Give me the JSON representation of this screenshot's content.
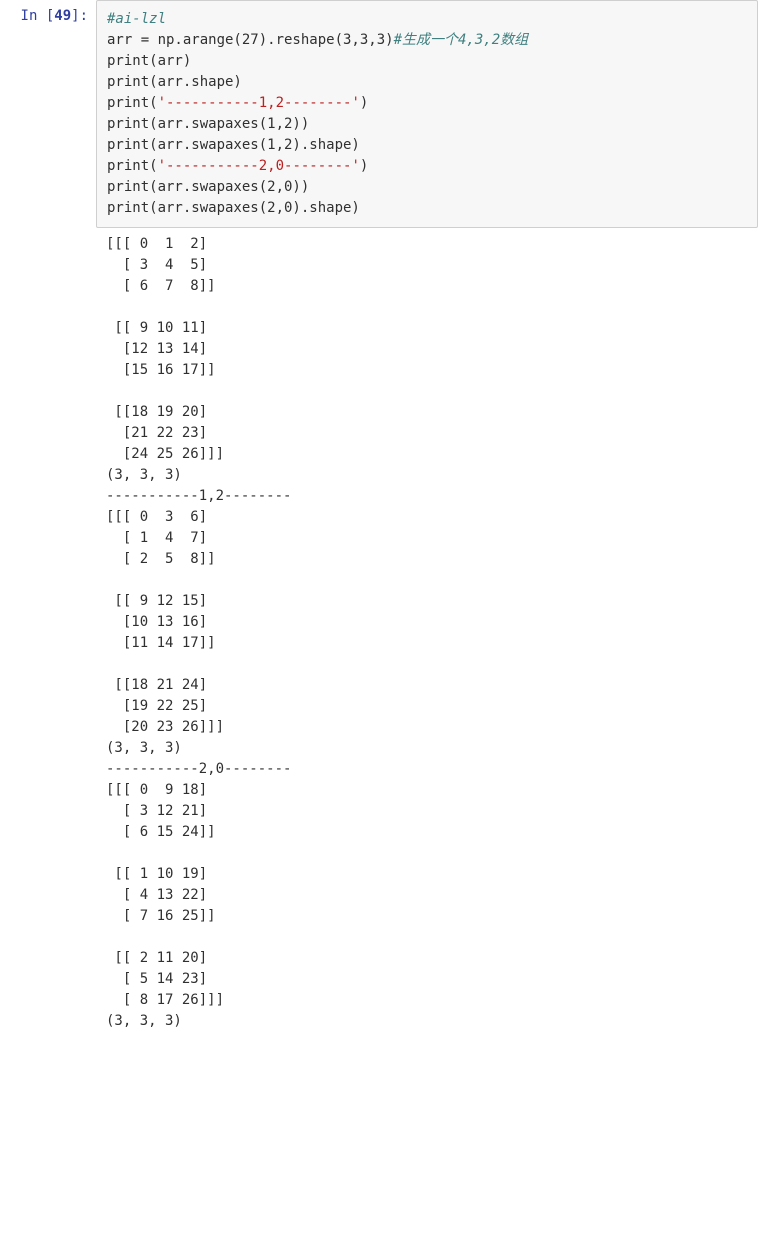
{
  "prompt": {
    "label": "In ",
    "open": "[",
    "number": "49",
    "close": "]:"
  },
  "code": {
    "line1_comment": "#ai-lzl",
    "line2_left": "arr = np.arange(27).reshape(3,3,3)",
    "line2_comment": "#生成一个4,3,2数组",
    "line3": "print(arr)",
    "line4": "print(arr.shape)",
    "line5_call": "print(",
    "line5_str": "'-----------1,2--------'",
    "line5_end": ")",
    "line6": "print(arr.swapaxes(1,2))",
    "line7": "print(arr.swapaxes(1,2).shape)",
    "line8_call": "print(",
    "line8_str": "'-----------2,0--------'",
    "line8_end": ")",
    "line9": "print(arr.swapaxes(2,0))",
    "line10": "print(arr.swapaxes(2,0).shape)"
  },
  "output": "[[[ 0  1  2]\n  [ 3  4  5]\n  [ 6  7  8]]\n\n [[ 9 10 11]\n  [12 13 14]\n  [15 16 17]]\n\n [[18 19 20]\n  [21 22 23]\n  [24 25 26]]]\n(3, 3, 3)\n-----------1,2--------\n[[[ 0  3  6]\n  [ 1  4  7]\n  [ 2  5  8]]\n\n [[ 9 12 15]\n  [10 13 16]\n  [11 14 17]]\n\n [[18 21 24]\n  [19 22 25]\n  [20 23 26]]]\n(3, 3, 3)\n-----------2,0--------\n[[[ 0  9 18]\n  [ 3 12 21]\n  [ 6 15 24]]\n\n [[ 1 10 19]\n  [ 4 13 22]\n  [ 7 16 25]]\n\n [[ 2 11 20]\n  [ 5 14 23]\n  [ 8 17 26]]]\n(3, 3, 3)"
}
